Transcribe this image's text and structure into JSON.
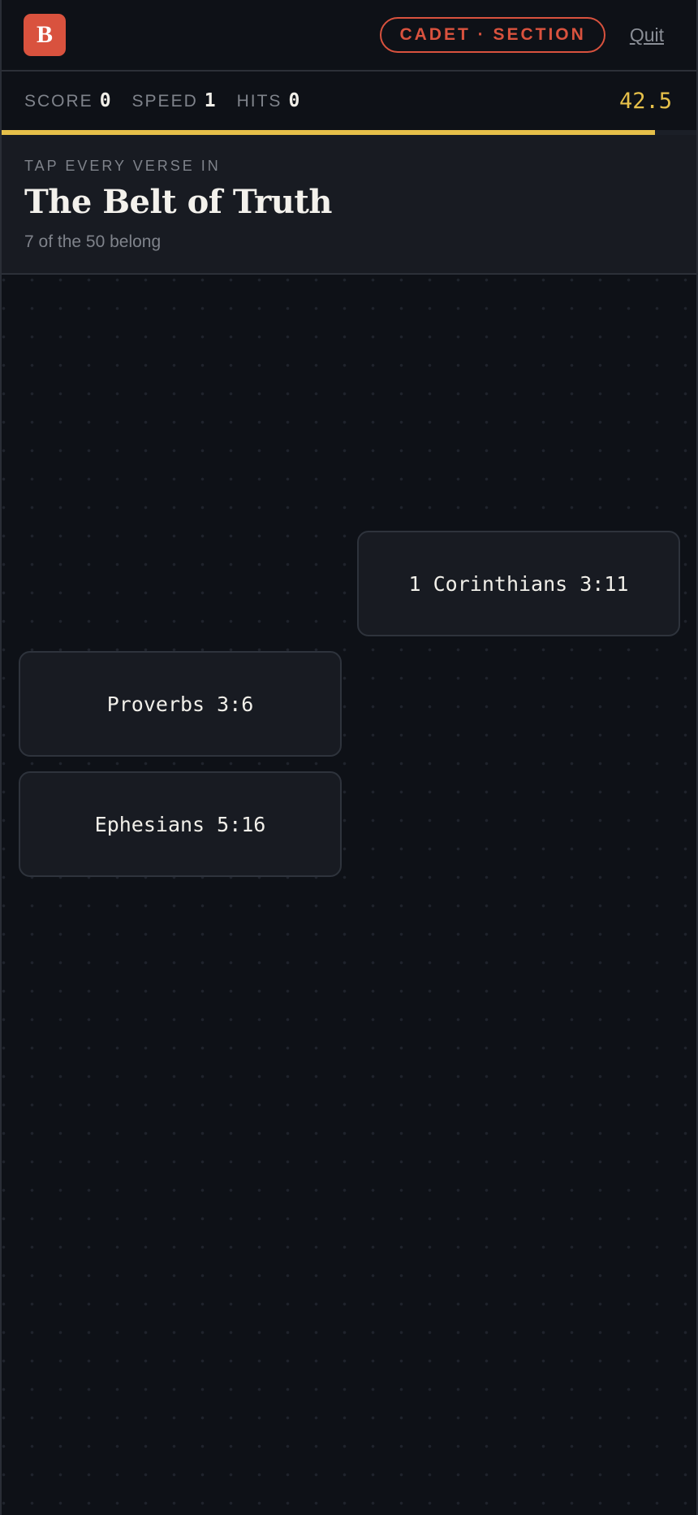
{
  "header": {
    "logo_letter": "B",
    "level_label": "CADET · SECTION",
    "quit_label": "Quit"
  },
  "stats": {
    "score_label": "SCORE",
    "score": "0",
    "speed_label": "SPEED",
    "speed": "1",
    "hits_label": "HITS",
    "hits": "0",
    "timer": "42.5",
    "time_remaining_fraction": 0.94
  },
  "prompt": {
    "kicker": "TAP EVERY VERSE IN",
    "title": "The Belt of Truth",
    "subtitle": "7 of the 50 belong"
  },
  "tiles": [
    {
      "label": "1 Corinthians 3:11"
    },
    {
      "label": "Proverbs 3:6"
    },
    {
      "label": "Ephesians 5:16"
    }
  ],
  "colors": {
    "accent": "#d9523e",
    "timer": "#e6c04a",
    "background": "#0e1117",
    "tile": "#181b22"
  }
}
